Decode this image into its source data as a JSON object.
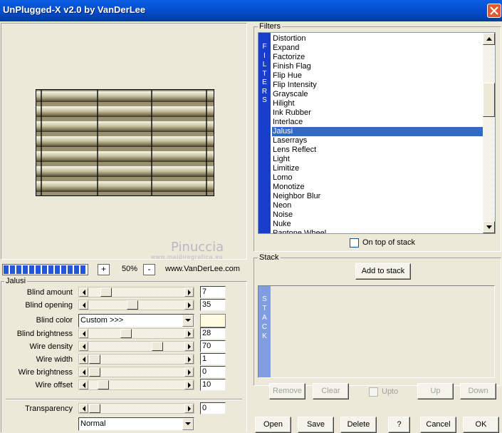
{
  "window": {
    "title": "UnPlugged-X v2.0 by VanDerLee"
  },
  "preview": {
    "watermark": "Pinuccia",
    "watermark_sub": "www.maidiregrafica.eu"
  },
  "zoom": {
    "minus": "-",
    "plus": "+",
    "value": "50%",
    "url": "www.VanDerLee.com",
    "progress_segments": 13
  },
  "jalusi": {
    "group_label": "Jalusi",
    "params": [
      {
        "label": "Blind amount",
        "value": "7",
        "position": 0.14
      },
      {
        "label": "Blind opening",
        "value": "35",
        "position": 0.45
      },
      {
        "label": "Blind brightness",
        "value": "28",
        "position": 0.38
      },
      {
        "label": "Wire density",
        "value": "70",
        "position": 0.75
      },
      {
        "label": "Wire width",
        "value": "1",
        "position": 0.0
      },
      {
        "label": "Wire brightness",
        "value": "0",
        "position": 0.0
      },
      {
        "label": "Wire offset",
        "value": "10",
        "position": 0.1
      }
    ],
    "blind_color_label": "Blind color",
    "blind_color_value": "Custom >>>",
    "blind_color_swatch": "#fffbe0",
    "transparency_label": "Transparency",
    "transparency_value": "0",
    "blend_mode": "Normal"
  },
  "filters": {
    "group_label": "Filters",
    "strip_letters": [
      "F",
      "I",
      "L",
      "T",
      "E",
      "R",
      "S"
    ],
    "items": [
      "Distortion",
      "Expand",
      "Factorize",
      "Finish Flag",
      "Flip Hue",
      "Flip Intensity",
      "Grayscale",
      "Hilight",
      "Ink Rubber",
      "Interlace",
      "Jalusi",
      "Laserrays",
      "Lens Reflect",
      "Light",
      "Limitize",
      "Lomo",
      "Monotize",
      "Neighbor Blur",
      "Neon",
      "Noise",
      "Nuke",
      "Pantone Wheel"
    ],
    "selected": "Jalusi",
    "on_top_label": "On top of stack"
  },
  "stack": {
    "group_label": "Stack",
    "add_label": "Add to stack",
    "strip_letters": [
      "S",
      "T",
      "A",
      "C",
      "K"
    ],
    "remove_label": "Remove",
    "clear_label": "Clear",
    "upto_label": "Upto",
    "up_label": "Up",
    "down_label": "Down"
  },
  "footer": {
    "open": "Open",
    "save": "Save",
    "delete": "Delete",
    "help": "?",
    "cancel": "Cancel",
    "ok": "OK"
  },
  "colors": {
    "accent": "#0453d6",
    "selection": "#316ac5",
    "filters_strip": "#1a3ecc",
    "stack_strip": "#7f9de0"
  }
}
